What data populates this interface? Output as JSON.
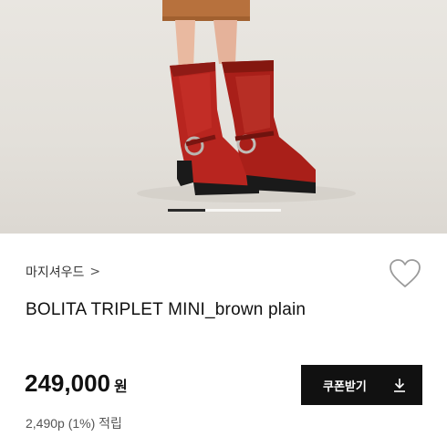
{
  "product": {
    "image_alt": "red leather harness boots",
    "gallery": {
      "current": 1,
      "progress": 0.33
    },
    "brand": {
      "label": "마지셔우드",
      "chevron": ">"
    },
    "name": "BOLITA TRIPLET MINI_brown plain",
    "wishlist_icon": "heart-outline-icon"
  },
  "pricing": {
    "amount": "249,000",
    "unit": "원",
    "points_text": "2,490p (1%) 적립"
  },
  "coupon_button": {
    "label": "쿠폰받기",
    "icon": "download-icon"
  },
  "colors": {
    "boot_red": "#b8251f",
    "button_bg": "#111111",
    "background": "#ffffff"
  }
}
